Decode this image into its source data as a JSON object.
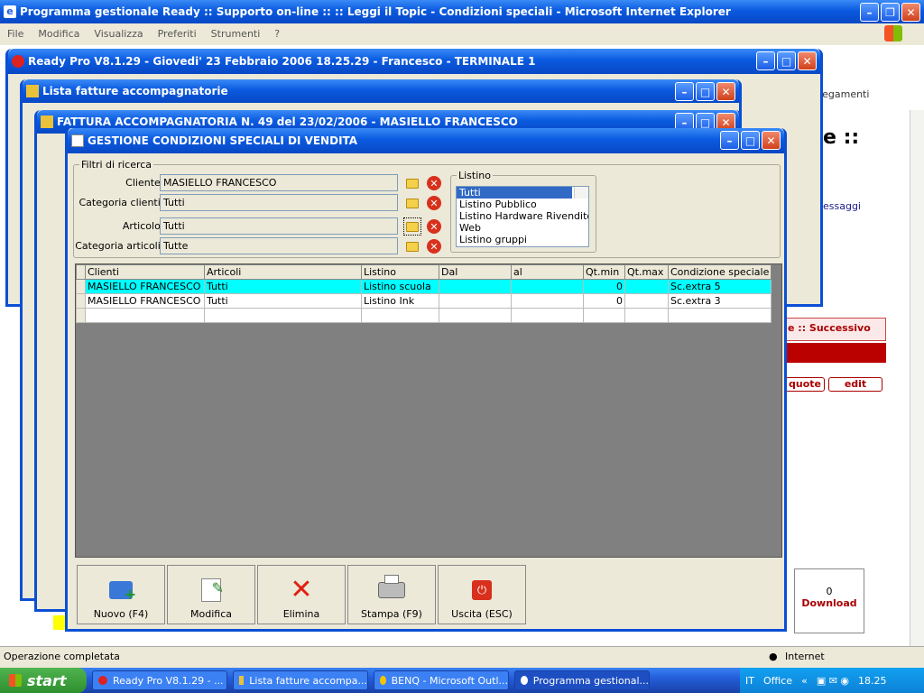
{
  "ie": {
    "title": "Programma gestionale Ready :: Supporto on-line :: :: Leggi il Topic - Condizioni speciali - Microsoft Internet Explorer",
    "menu": [
      "File",
      "Modifica",
      "Visualizza",
      "Preferiti",
      "Strumenti",
      "?"
    ],
    "links_label": "llegamenti",
    "page_text_1": "e ::",
    "page_text_2": "essaggi",
    "page_text_3": "e :: Successivo",
    "quote_label": "quote",
    "edit_label": "edit",
    "download_label": "Download",
    "download_count": "0",
    "status_text": "Operazione completata",
    "zone_label": "Internet"
  },
  "ready_window": {
    "title": "Ready Pro V8.1.29 - Giovedi' 23 Febbraio 2006  18.25.29 - Francesco - TERMINALE 1"
  },
  "fatture_window": {
    "title": "Lista fatture accompagnatorie"
  },
  "fattura_window": {
    "title": "FATTURA ACCOMPAGNATORIA N. 49  del 23/02/2006 - MASIELLO FRANCESCO"
  },
  "dialog": {
    "title": "GESTIONE CONDIZIONI SPECIALI DI VENDITA",
    "filters": {
      "group_label": "Filtri di ricerca",
      "cliente_label": "Cliente :",
      "cliente_value": "MASIELLO FRANCESCO",
      "catcli_label": "Categoria clienti :",
      "catcli_value": "Tutti",
      "articolo_label": "Articolo :",
      "articolo_value": "Tutti",
      "catart_label": "Categoria articoli :",
      "catart_value": "Tutte"
    },
    "listino": {
      "group_label": "Listino",
      "items": [
        "Tutti",
        "Listino Pubblico",
        "Listino Hardware Rivenditori",
        "Web",
        "Listino gruppi"
      ]
    },
    "grid": {
      "columns": [
        "Clienti",
        "Articoli",
        "Listino",
        "Dal",
        "al",
        "Qt.min",
        "Qt.max",
        "Condizione speciale"
      ],
      "rows": [
        [
          "MASIELLO FRANCESCO",
          "Tutti",
          "Listino scuola",
          "",
          "",
          "0",
          "",
          "Sc.extra 5"
        ],
        [
          "MASIELLO FRANCESCO",
          "Tutti",
          "Listino Ink",
          "",
          "",
          "0",
          "",
          "Sc.extra 3"
        ]
      ]
    },
    "buttons": {
      "nuovo": "Nuovo (F4)",
      "modifica": "Modifica",
      "elimina": "Elimina",
      "stampa": "Stampa (F9)",
      "uscita": "Uscita (ESC)"
    }
  },
  "taskbar": {
    "start": "start",
    "tasks": [
      "Ready Pro V8.1.29 - ...",
      "Lista fatture accompa...",
      "BENQ - Microsoft Outl...",
      "Programma gestional..."
    ],
    "lang": "IT",
    "office": "Office",
    "clock": "18.25"
  }
}
